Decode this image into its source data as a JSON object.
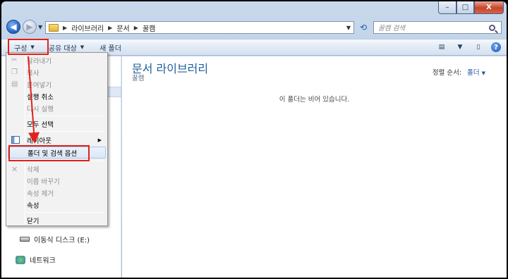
{
  "address": {
    "crumbs": [
      "라이브러리",
      "문서",
      "꿀캠"
    ],
    "search_placeholder": "꿀캠 검색"
  },
  "caption": {
    "minimize": "–",
    "maximize": "□",
    "close": "X"
  },
  "cmdbar": {
    "organize": "구성",
    "share": "공유 대상",
    "new_folder": "새 폴더"
  },
  "menu": {
    "items": [
      {
        "label": "잘라내기",
        "enabled": false,
        "icon": "scissors-icon"
      },
      {
        "label": "복사",
        "enabled": false,
        "icon": "copy-icon"
      },
      {
        "label": "붙여넣기",
        "enabled": false,
        "icon": "paste-icon"
      },
      {
        "label": "실행 취소",
        "enabled": true
      },
      {
        "label": "다시 실행",
        "enabled": false
      },
      {
        "label": "모두 선택",
        "enabled": true
      },
      {
        "label": "레이아웃",
        "enabled": true,
        "icon": "layout-icon",
        "submenu": true
      },
      {
        "label": "폴더 및 검색 옵션",
        "enabled": true,
        "highlighted": true
      },
      {
        "label": "삭제",
        "enabled": false,
        "icon": "delete-icon"
      },
      {
        "label": "이름 바꾸기",
        "enabled": false
      },
      {
        "label": "속성 제거",
        "enabled": false
      },
      {
        "label": "속성",
        "enabled": true
      },
      {
        "label": "닫기",
        "enabled": true
      }
    ]
  },
  "main": {
    "library_title": "문서 라이브러리",
    "library_subtitle": "꿀캠",
    "arrange_label": "정렬 순서:",
    "arrange_value": "폴더",
    "empty_message": "이 폴더는 비어 있습니다."
  },
  "navpane": {
    "removable_disk": "이동식 디스크 (E:)",
    "network": "네트워크"
  },
  "colors": {
    "annotation_red": "#e3211a",
    "title_blue": "#1e5f9a"
  }
}
